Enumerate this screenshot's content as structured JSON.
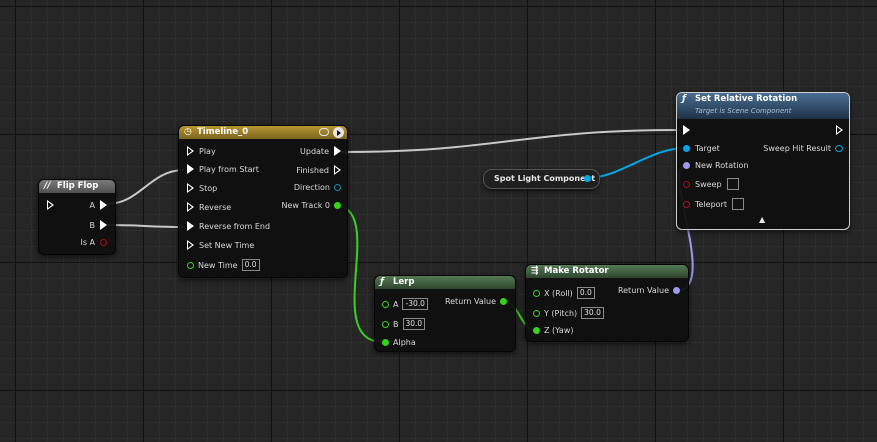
{
  "colors": {
    "exec": "#ffffff",
    "float": "#36d31b",
    "object": "#00a6e8",
    "rotator": "#9d9af2",
    "bool": "#8c0e0e",
    "flipflop_header": "#6e6e6e",
    "timeline_header": "#a38628",
    "function_header": "#3d5a7a",
    "pure_header": "#3e5e3e"
  },
  "flip_flop": {
    "title": "Flip Flop",
    "icon": "flip-flop-icon",
    "out_a": "A",
    "out_b": "B",
    "is_a": "Is A"
  },
  "timeline": {
    "title": "Timeline_0",
    "icon": "clock-icon",
    "inputs": [
      "Play",
      "Play from Start",
      "Stop",
      "Reverse",
      "Reverse from End",
      "Set New Time"
    ],
    "new_time_label": "New Time",
    "new_time_value": "0.0",
    "outputs": [
      "Update",
      "Finished",
      "Direction",
      "New Track 0"
    ]
  },
  "set_relative_rotation": {
    "title": "Set Relative Rotation",
    "subtitle": "Target is Scene Component",
    "icon": "function-icon",
    "target": "Target",
    "new_rotation": "New Rotation",
    "sweep": "Sweep",
    "teleport": "Teleport",
    "sweep_hit_result": "Sweep Hit Result",
    "expand_icon": "chevron-up-icon"
  },
  "spot_light": {
    "label": "Spot Light Component"
  },
  "lerp": {
    "title": "Lerp",
    "icon": "function-icon",
    "a_label": "A",
    "a_value": "-30.0",
    "b_label": "B",
    "b_value": "30.0",
    "alpha_label": "Alpha",
    "return_label": "Return Value"
  },
  "make_rotator": {
    "title": "Make Rotator",
    "icon": "make-struct-icon",
    "x_label": "X (Roll)",
    "x_value": "0.0",
    "y_label": "Y (Pitch)",
    "y_value": "30.0",
    "z_label": "Z (Yaw)",
    "return_label": "Return Value"
  }
}
